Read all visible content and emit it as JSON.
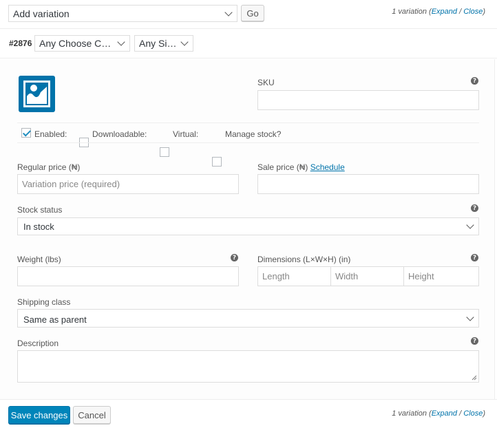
{
  "toolbar": {
    "add_variation": "Add variation",
    "go_label": "Go",
    "count_text": "1 variation",
    "paren_open": "(",
    "expand": "Expand",
    "slash": " / ",
    "close": "Close",
    "paren_close": ")"
  },
  "variation": {
    "id": "#2876",
    "color_select": "Any Choose Color…",
    "size_select": "Any Size…"
  },
  "form": {
    "sku_label": "SKU",
    "enabled_label": "Enabled:",
    "enabled_checked": true,
    "downloadable_label": "Downloadable:",
    "virtual_label": "Virtual:",
    "manage_stock_label": "Manage stock?",
    "regular_price_label": "Regular price (₦)",
    "regular_price_placeholder": "Variation price (required)",
    "sale_price_label": "Sale price (₦)",
    "schedule_link": "Schedule",
    "stock_status_label": "Stock status",
    "stock_status_value": "In stock",
    "weight_label": "Weight (lbs)",
    "dimensions_label": "Dimensions (L×W×H) (in)",
    "length_placeholder": "Length",
    "width_placeholder": "Width",
    "height_placeholder": "Height",
    "shipping_class_label": "Shipping class",
    "shipping_class_value": "Same as parent",
    "description_label": "Description",
    "help_glyph": "?"
  },
  "footer": {
    "save_label": "Save changes",
    "cancel_label": "Cancel",
    "count_text": "1 variation",
    "paren_open": "(",
    "expand": "Expand",
    "slash": " / ",
    "close": "Close",
    "paren_close": ")"
  },
  "colors": {
    "primary": "#0085ba",
    "link": "#0073aa",
    "image_placeholder": "#0073aa"
  },
  "icons": {
    "image_placeholder": "image-placeholder-icon",
    "help": "question-circle-icon",
    "chevron": "chevron-down-icon",
    "check": "checkmark-icon"
  }
}
